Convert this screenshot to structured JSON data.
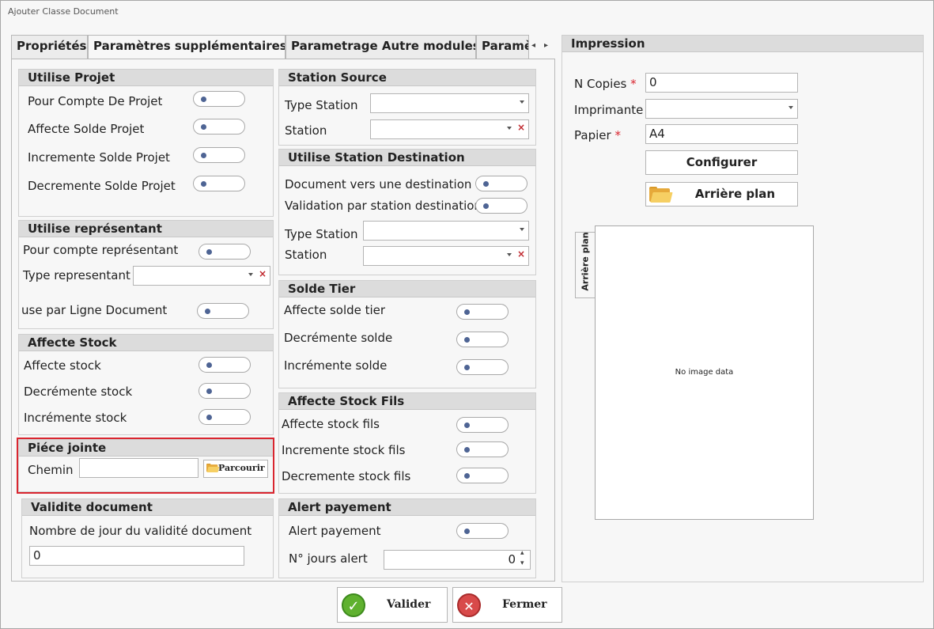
{
  "window": {
    "title": "Ajouter Classe Document"
  },
  "tabs": [
    {
      "label": "Propriétés"
    },
    {
      "label": "Paramètres supplémentaires"
    },
    {
      "label": "Parametrage Autre modules"
    },
    {
      "label": "Paramè"
    }
  ],
  "tab_nav": {
    "prev": "◂",
    "next": "▸"
  },
  "utilise_projet": {
    "title": "Utilise Projet",
    "items": [
      "Pour Compte De Projet",
      "Affecte Solde Projet",
      "Incremente Solde Projet",
      "Decremente Solde Projet"
    ]
  },
  "utilise_representant": {
    "title": "Utilise représentant",
    "pour_compte": "Pour compte représentant",
    "type_label": "Type representant",
    "ligne_doc": "use par Ligne Document"
  },
  "affecte_stock": {
    "title": "Affecte Stock",
    "items": [
      "Affecte stock",
      "Decrémente stock",
      "Incrémente stock"
    ]
  },
  "piece_jointe": {
    "title": "Piéce jointe",
    "chemin_label": "Chemin",
    "chemin_value": "",
    "browse_label": "Parcourir"
  },
  "validite": {
    "title": "Validite document",
    "label": "Nombre de jour du validité document",
    "value": "0"
  },
  "station_source": {
    "title": "Station Source",
    "type_label": "Type Station",
    "station_label": "Station"
  },
  "station_destination": {
    "title": "Utilise Station Destination",
    "doc_dest": "Document vers une destination",
    "validation": "Validation par station destination",
    "type_label": "Type Station",
    "station_label": "Station"
  },
  "solde_tier": {
    "title": "Solde Tier",
    "items": [
      "Affecte solde tier",
      "Decrémente solde",
      "Incrémente solde"
    ]
  },
  "stock_fils": {
    "title": "Affecte Stock Fils",
    "items": [
      "Affecte stock fils",
      "Incremente stock fils",
      "Decremente stock fils"
    ]
  },
  "alert_payement": {
    "title": "Alert payement",
    "toggle_label": "Alert payement",
    "jours_label": "N° jours alert",
    "jours_value": "0",
    "spin_up": "▴",
    "spin_down": "▾"
  },
  "impression": {
    "title": "Impression",
    "copies_label": "N Copies",
    "copies_value": "0",
    "required_mark": "*",
    "imprimante_label": "Imprimante",
    "papier_label": "Papier",
    "papier_value": "A4",
    "configurer": "Configurer",
    "arriere_plan_btn": "Arrière plan",
    "arriere_plan_tab": "Arrière plan",
    "no_image": "No image data"
  },
  "footer": {
    "valider": "Valider",
    "fermer": "Fermer"
  },
  "colors": {
    "accent_red": "#d9252f",
    "toggle_knob": "#4e6494",
    "ok_green": "#5fb12f",
    "close_red": "#d84a4a"
  }
}
